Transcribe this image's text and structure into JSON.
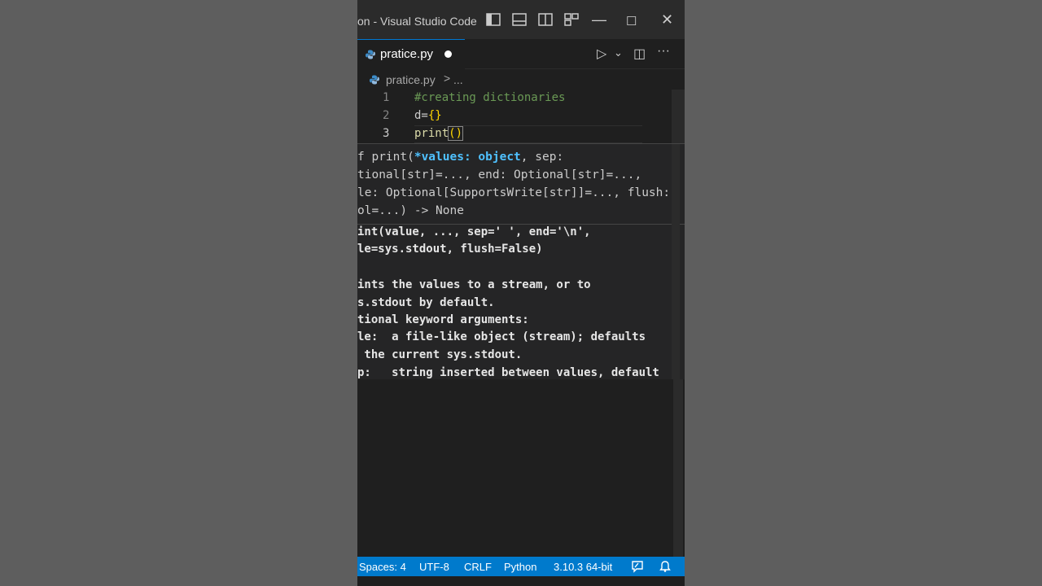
{
  "window": {
    "title": "on - Visual Studio Code",
    "controls": {
      "minimize": "—",
      "maximize": "☐",
      "close": "✕"
    }
  },
  "tab": {
    "filename": "pratice.py",
    "modified": true,
    "icon": "python-icon"
  },
  "tab_actions": {
    "run": "▷",
    "run_menu": "⌄",
    "split": "◫",
    "more": "···"
  },
  "breadcrumb": {
    "file": "pratice.py",
    "separator": ">",
    "more": "..."
  },
  "editor": {
    "lines": [
      {
        "number": "1",
        "code": "#creating dictionaries"
      },
      {
        "number": "2",
        "code_prefix": "d=",
        "code_brace": "{}"
      },
      {
        "number": "3",
        "code_prefix": "print",
        "code_paren": "()"
      }
    ]
  },
  "hover": {
    "signature": [
      "f print(",
      "*values: object",
      ", sep:",
      "tional[str]=..., end: Optional[str]=...,",
      "le: Optional[SupportsWrite[str]]=..., flush:",
      "ol=...) -> None"
    ],
    "doc": [
      "int(value, ..., sep=' ', end='\\n',",
      "le=sys.stdout, flush=False)",
      "",
      "ints the values to a stream, or to",
      "s.stdout by default.",
      "tional keyword arguments:",
      "le:  a file-like object (stream); defaults",
      " the current sys.stdout.",
      "p:   string inserted between values, default"
    ]
  },
  "statusbar": {
    "spaces": "Spaces: 4",
    "encoding": "UTF-8",
    "eol": "CRLF",
    "language": "Python",
    "interpreter": "3.10.3 64-bit",
    "feedback_icon": "feedback-icon",
    "bell_icon": "bell-icon"
  },
  "colors": {
    "statusbar": "#007acc",
    "comment": "#6a9955",
    "brace": "#ffd700",
    "param": "#4fc1ff"
  }
}
